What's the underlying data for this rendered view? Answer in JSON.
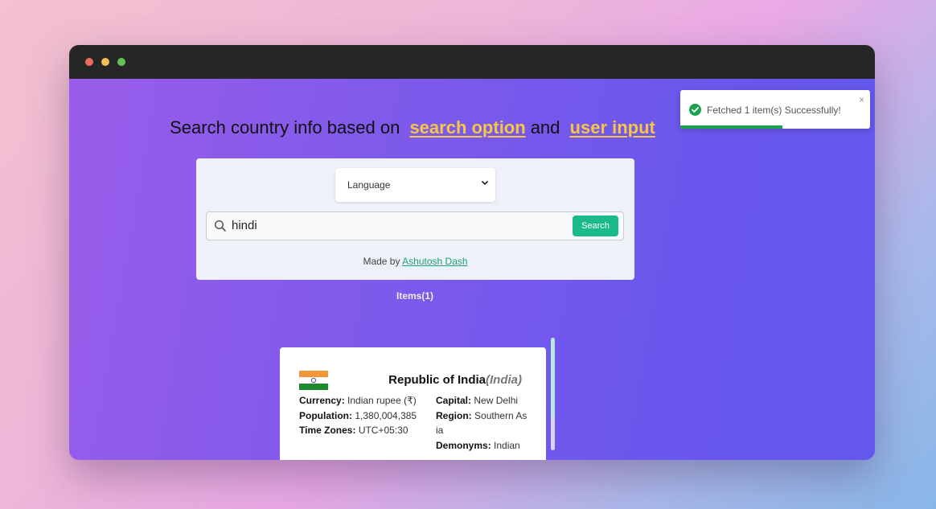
{
  "headline": {
    "prefix": "Search country info based on",
    "option": "search option",
    "conj": "and",
    "input": "user input"
  },
  "search": {
    "option_selected": "Language",
    "value": "hindi",
    "button_label": "Search"
  },
  "credit": {
    "prefix": "Made by",
    "author": "Ashutosh Dash"
  },
  "items_label": "Items(1)",
  "card": {
    "official_name": "Republic of India",
    "common_name": "(India)",
    "currency_label": "Currency:",
    "currency": "Indian rupee (₹)",
    "population_label": "Population:",
    "population": "1,380,004,385",
    "timezones_label": "Time Zones:",
    "timezones": "UTC+05:30",
    "capital_label": "Capital:",
    "capital": "New Delhi",
    "region_label": "Region:",
    "region": "Southern As ia",
    "demonyms_label": "Demonyms:",
    "demonyms": "Indian"
  },
  "toast": {
    "message": "Fetched 1 item(s) Successfully!",
    "close": "×",
    "progress": 0.54
  },
  "colors": {
    "accent_green": "#1aba89",
    "highlight_yellow": "#f7c744",
    "toast_success": "#1aa34a"
  }
}
